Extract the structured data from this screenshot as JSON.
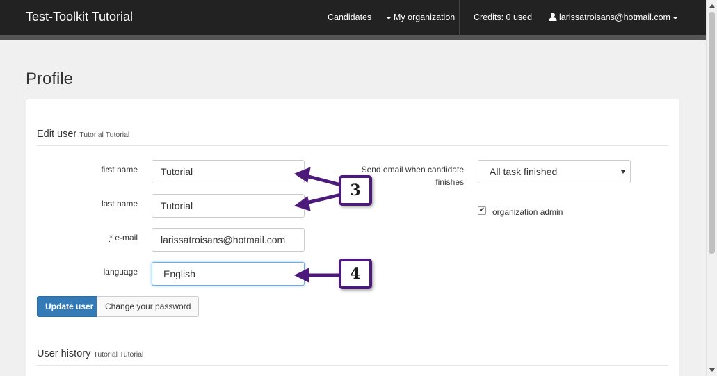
{
  "navbar": {
    "brand": "Test-Toolkit Tutorial",
    "candidates": "Candidates",
    "my_organization": "My organization",
    "credits": "Credits: 0 used",
    "user_email": "larissatroisans@hotmail.com",
    "background_color": "#222222"
  },
  "page": {
    "title": "Profile"
  },
  "edit_user": {
    "heading": "Edit user",
    "heading_sub": "Tutorial Tutorial",
    "first_name_label": "first name",
    "first_name_value": "Tutorial",
    "last_name_label": "last name",
    "last_name_value": "Tutorial",
    "email_required_mark": "*",
    "email_label": "e-mail",
    "email_value": "larissatroisans@hotmail.com",
    "language_label": "language",
    "language_value": "English",
    "send_email_label_line1": "Send email when candidate",
    "send_email_label_line2": "finishes",
    "send_email_value": "All task finished",
    "org_admin_label": "organization admin",
    "org_admin_checked": true,
    "update_button": "Update user",
    "change_password_button": "Change your password",
    "primary_color": "#337ab7"
  },
  "user_history": {
    "heading": "User history",
    "heading_sub": "Tutorial Tutorial"
  },
  "annotations": {
    "callout_3": "3",
    "callout_4": "4",
    "callout_color": "#4b1a7a"
  }
}
